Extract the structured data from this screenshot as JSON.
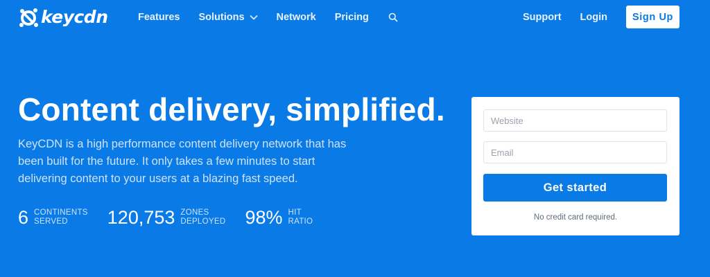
{
  "brand": {
    "logo_text": "keycdn",
    "accent": "#0a7ae6"
  },
  "nav": {
    "items": [
      {
        "label": "Features"
      },
      {
        "label": "Solutions"
      },
      {
        "label": "Network"
      },
      {
        "label": "Pricing"
      }
    ],
    "search_icon": "search-icon"
  },
  "right_nav": {
    "support": "Support",
    "login": "Login",
    "signup": "Sign Up"
  },
  "hero": {
    "title": "Content delivery, simplified.",
    "description": "KeyCDN is a high performance content delivery network that has been built for the future. It only takes a few minutes to start delivering content to your users at a blazing fast speed."
  },
  "stats": [
    {
      "value": "6",
      "label_line1": "CONTINENTS",
      "label_line2": "SERVED"
    },
    {
      "value": "120,753",
      "label_line1": "ZONES",
      "label_line2": "DEPLOYED"
    },
    {
      "value": "98%",
      "label_line1": "HIT",
      "label_line2": "RATIO"
    }
  ],
  "form": {
    "website_placeholder": "Website",
    "email_placeholder": "Email",
    "cta": "Get started",
    "note": "No credit card required."
  }
}
